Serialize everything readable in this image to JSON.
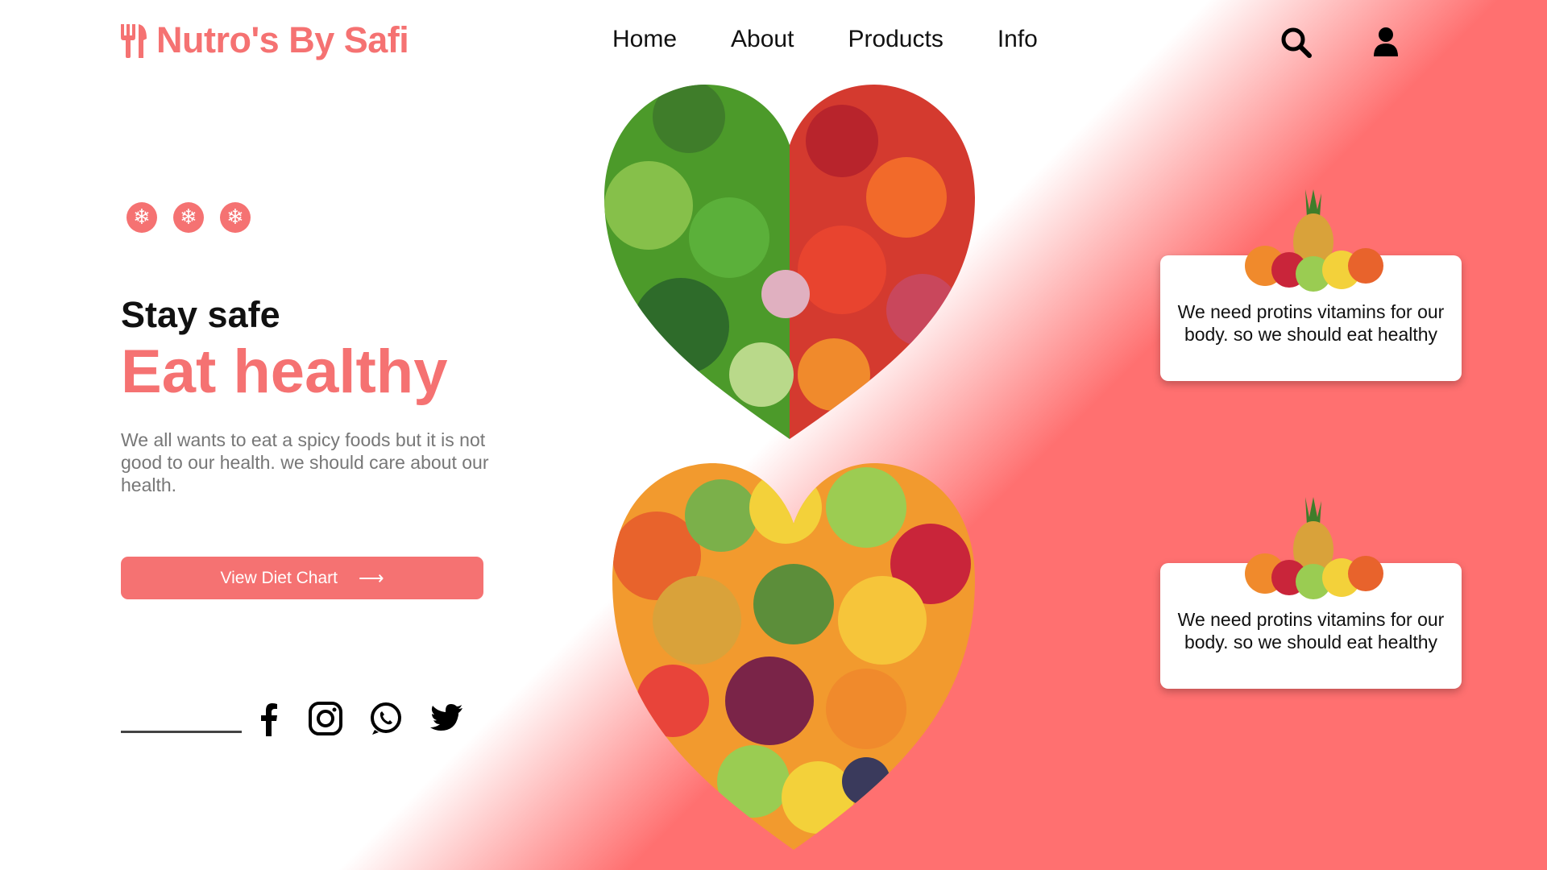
{
  "header": {
    "brand": "Nutro's By Safi",
    "logo_icon": "fork-knife-icon",
    "nav": [
      {
        "label": "Home"
      },
      {
        "label": "About"
      },
      {
        "label": "Products"
      },
      {
        "label": "Info"
      }
    ],
    "icons": [
      "search-icon",
      "user-icon"
    ]
  },
  "hero": {
    "snowflake_icons": [
      "snowflake-icon",
      "snowflake-icon",
      "snowflake-icon"
    ],
    "tagline_small": "Stay safe",
    "tagline_large": "Eat healthy",
    "description": "We all wants to eat a spicy foods but it is not good to our health. we should care about our health.",
    "cta_label": "View Diet Chart",
    "cta_icon": "arrow-right-icon"
  },
  "social": [
    "facebook-icon",
    "instagram-icon",
    "whatsapp-icon",
    "twitter-icon"
  ],
  "cards": [
    {
      "text": "We need protins vitamins for our body. so we should eat healthy"
    },
    {
      "text": "We need protins vitamins for our body. so we should eat healthy"
    }
  ],
  "colors": {
    "accent": "#f57272",
    "gradient_end": "#ff7070",
    "text_dark": "#111111",
    "text_muted": "#777777"
  }
}
